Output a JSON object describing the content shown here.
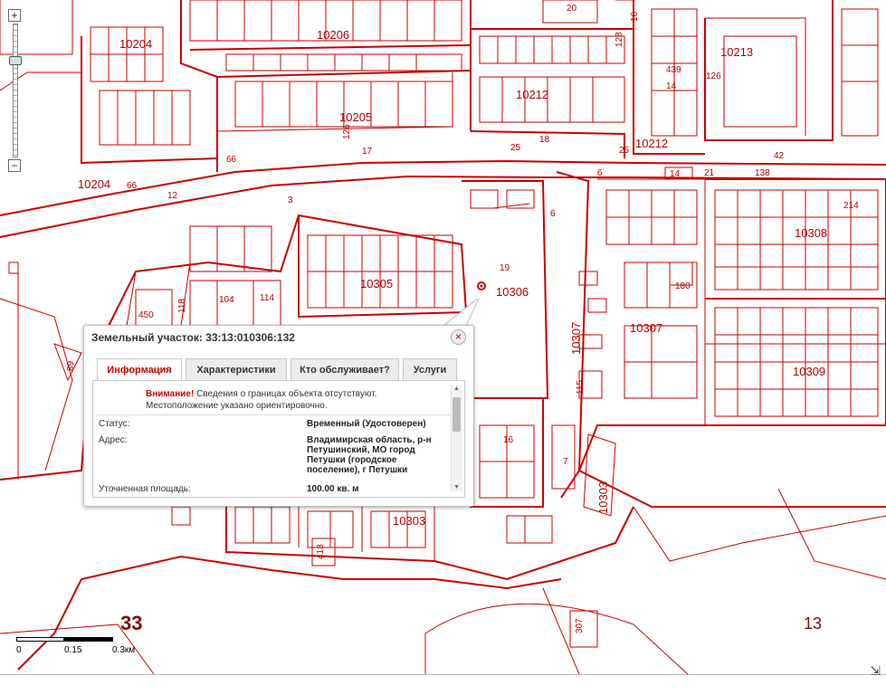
{
  "map": {
    "labels": {
      "q10204a": "10204",
      "q10206": "10206",
      "q10205": "10205",
      "q10212a": "10212",
      "q10212b": "10212",
      "q10213": "10213",
      "q10204b": "10204",
      "q10308": "10308",
      "q10305": "10305",
      "q10306": "10306",
      "q10307": "10307",
      "q10307v": "10307",
      "q10309": "10309",
      "q10303": "10303",
      "q10303v": "10303",
      "district33": "33",
      "district13": "13",
      "n20": "20",
      "n16": "16",
      "n128": "128",
      "n439": "439",
      "n126": "126",
      "n14a": "14",
      "n126v": "126",
      "n17": "17",
      "n25a": "25",
      "n18": "18",
      "n25b": "25",
      "n42": "42",
      "n66a": "66",
      "n66b": "66",
      "n12": "12",
      "n3": "3",
      "n6": "6",
      "n14b": "14",
      "n21": "21",
      "n138": "138",
      "n214": "214",
      "n19": "19",
      "n104": "104",
      "n114": "114",
      "n450": "450",
      "n118": "118",
      "n180": "180",
      "n89": "89",
      "n115": "115",
      "n16b": "16",
      "n7": "7",
      "n413": "413",
      "n307": "307"
    }
  },
  "zoom": {
    "plus": "+",
    "minus": "−"
  },
  "scale": {
    "t0": "0",
    "t1": "0.15",
    "t2": "0.3км"
  },
  "popup": {
    "title": "Земельный участок: 33:13:010306:132",
    "close": "×",
    "tabs": [
      "Информация",
      "Характеристики",
      "Кто обслуживает?",
      "Услуги"
    ],
    "warning_bold": "Внимание!",
    "warning_text1": " Сведения о границах объекта отсутствуют.",
    "warning_text2": "Местоположение указано ориентировочно.",
    "rows": [
      {
        "label": "Статус:",
        "value": "Временный (Удостоверен)"
      },
      {
        "label": "Адрес:",
        "value": "Владимирская область, р-н Петушинский, МО город Петушки (городское поселение), г Петушки"
      },
      {
        "label": "Уточненная площадь:",
        "value": "100.00 кв. м"
      }
    ]
  },
  "colors": {
    "parcel": "#c80000",
    "accent": "#c00000"
  }
}
